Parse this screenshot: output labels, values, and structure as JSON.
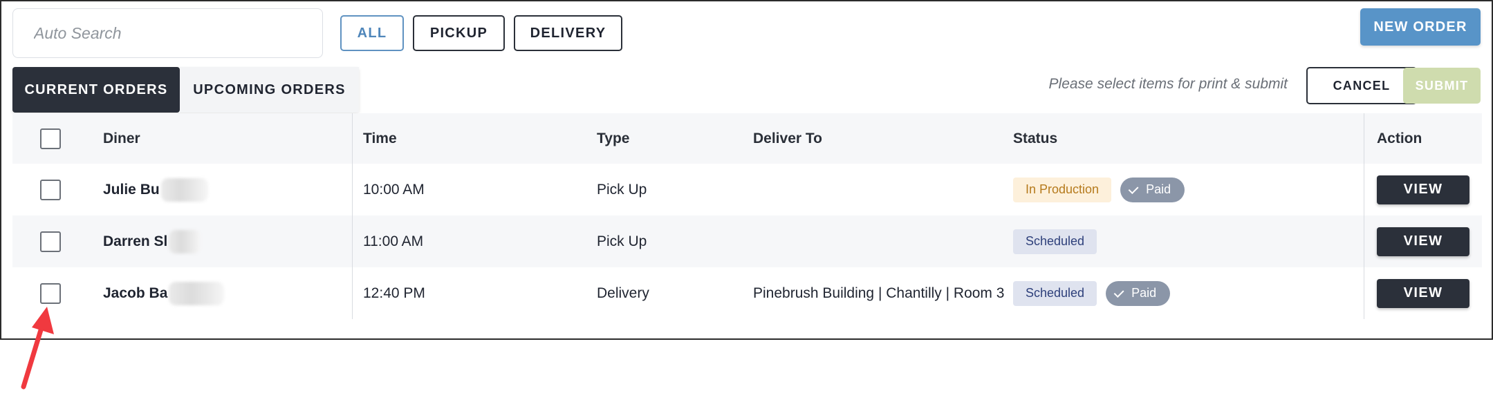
{
  "search": {
    "placeholder": "Auto Search",
    "value": ""
  },
  "filters": [
    {
      "label": "ALL",
      "active": true
    },
    {
      "label": "PICKUP",
      "active": false
    },
    {
      "label": "DELIVERY",
      "active": false
    }
  ],
  "new_order_label": "NEW ORDER",
  "tabs": [
    {
      "label": "CURRENT ORDERS",
      "active": true
    },
    {
      "label": "UPCOMING ORDERS",
      "active": false
    }
  ],
  "print_hint": "Please select items for print & submit",
  "cancel_label": "CANCEL",
  "submit_label": "SUBMIT",
  "table": {
    "headers": {
      "diner": "Diner",
      "time": "Time",
      "type": "Type",
      "deliver_to": "Deliver To",
      "status": "Status",
      "action": "Action"
    },
    "rows": [
      {
        "diner": "Julie Bu",
        "time": "10:00 AM",
        "type": "Pick Up",
        "deliver_to": "",
        "status": "In Production",
        "payment": "Paid",
        "action": "VIEW"
      },
      {
        "diner": "Darren Sl",
        "time": "11:00 AM",
        "type": "Pick Up",
        "deliver_to": "",
        "status": "Scheduled",
        "payment": "",
        "action": "VIEW"
      },
      {
        "diner": "Jacob Ba",
        "time": "12:40 PM",
        "type": "Delivery",
        "deliver_to": "Pinebrush Building | Chantilly | Room 3",
        "status": "Scheduled",
        "payment": "Paid",
        "action": "VIEW"
      }
    ]
  },
  "colors": {
    "accent_blue": "#5894c8",
    "dark": "#2b303a",
    "submit_disabled": "#cfdcae",
    "status_production_bg": "#fdf0db",
    "status_scheduled_bg": "#dfe3ef",
    "paid_bg": "#8b96a8",
    "annotation_arrow": "#f0393f"
  }
}
